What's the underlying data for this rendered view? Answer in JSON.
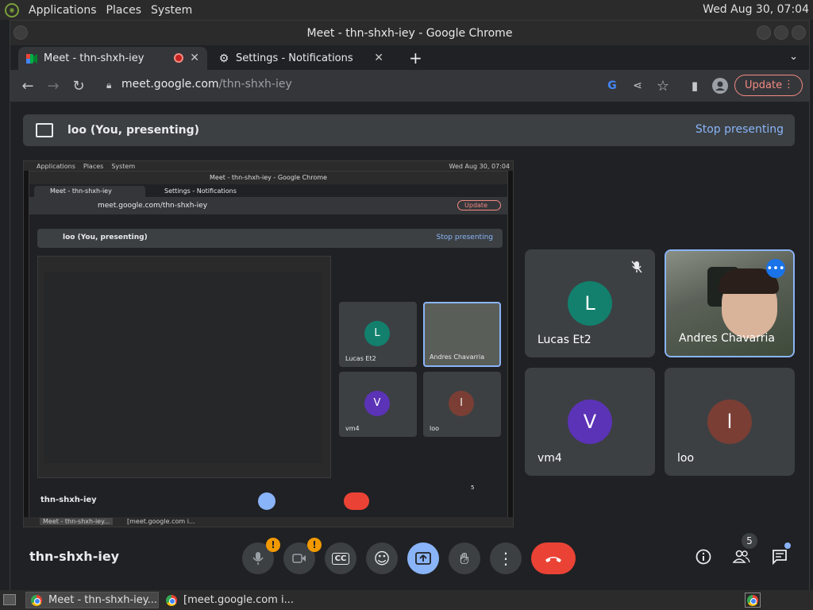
{
  "top_bar": {
    "menus": [
      "Applications",
      "Places",
      "System"
    ],
    "clock": "Wed Aug 30, 07:04"
  },
  "window": {
    "title": "Meet - thn-shxh-iey - Google Chrome"
  },
  "tabs": [
    {
      "label": "Meet - thn-shxh-iey",
      "active": true
    },
    {
      "label": "Settings - Notifications",
      "active": false
    }
  ],
  "toolbar": {
    "url_host": "meet.google.com",
    "url_path": "/thn-shxh-iey",
    "update_label": "Update"
  },
  "presenting_bar": {
    "label": "loo (You, presenting)",
    "stop_label": "Stop presenting"
  },
  "screenshare_preview": {
    "top_bar_menus": [
      "Applications",
      "Places",
      "System"
    ],
    "clock": "Wed Aug 30, 07:04",
    "window_title": "Meet - thn-shxh-iey - Google Chrome",
    "tab1": "Meet - thn-shxh-iey",
    "tab2": "Settings - Notifications",
    "url": "meet.google.com/thn-shxh-iey",
    "update_label": "Update",
    "presenting_label": "loo (You, presenting)",
    "stop_label": "Stop presenting",
    "meeting_code": "thn-shxh-iey",
    "people_count": "5",
    "participants": [
      "Lucas Et2",
      "Andres Chavarria",
      "vm4",
      "loo"
    ],
    "task1": "Meet - thn-shxh-iey...",
    "task2": "[meet.google.com i..."
  },
  "participants": [
    {
      "name": "Lucas Et2",
      "initial": "L",
      "color": "#12806d",
      "muted": true
    },
    {
      "name": "Andres Chavarria",
      "video": true
    },
    {
      "name": "vm4",
      "initial": "V",
      "color": "#5b33b6"
    },
    {
      "name": "loo",
      "initial": "l",
      "color": "#7a3e35"
    }
  ],
  "controls": {
    "meeting_code": "thn-shxh-iey",
    "people_count": "5",
    "warning_mark": "!"
  },
  "taskbar": [
    {
      "label": "Meet - thn-shxh-iey...",
      "active": true
    },
    {
      "label": "[meet.google.com i...",
      "active": false
    }
  ],
  "colors": {
    "accent": "#8ab4f8",
    "end_call": "#ea4335",
    "warning": "#f29900",
    "update": "#f28b82"
  }
}
